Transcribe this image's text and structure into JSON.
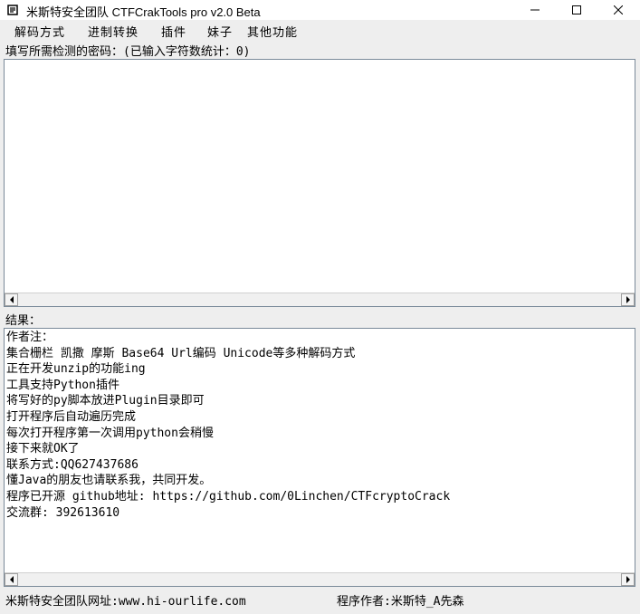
{
  "window": {
    "title": "米斯特安全团队 CTFCrakTools pro v2.0 Beta"
  },
  "menu": {
    "items": [
      "解码方式",
      "进制转换",
      "插件",
      "妹子",
      "其他功能"
    ]
  },
  "input": {
    "label": "填写所需检测的密码：(已输入字符数统计：0)",
    "value": ""
  },
  "result": {
    "label": "结果：",
    "lines": [
      "作者注：",
      "集合栅栏 凯撒 摩斯 Base64 Url编码 Unicode等多种解码方式",
      "正在开发unzip的功能ing",
      "工具支持Python插件",
      "将写好的py脚本放进Plugin目录即可",
      "打开程序后自动遍历完成",
      "每次打开程序第一次调用python会稍慢",
      "接下来就OK了",
      "联系方式:QQ627437686",
      "懂Java的朋友也请联系我，共同开发。",
      "程序已开源 github地址: https://github.com/0Linchen/CTFcryptoCrack",
      "交流群: 392613610"
    ]
  },
  "status": {
    "left": "米斯特安全团队网址:www.hi-ourlife.com",
    "right": "程序作者:米斯特_A先森"
  },
  "icons": {
    "app": "app-icon",
    "minimize": "minimize-icon",
    "maximize": "maximize-icon",
    "close": "close-icon",
    "scroll_left": "scroll-left-icon",
    "scroll_right": "scroll-right-icon"
  }
}
